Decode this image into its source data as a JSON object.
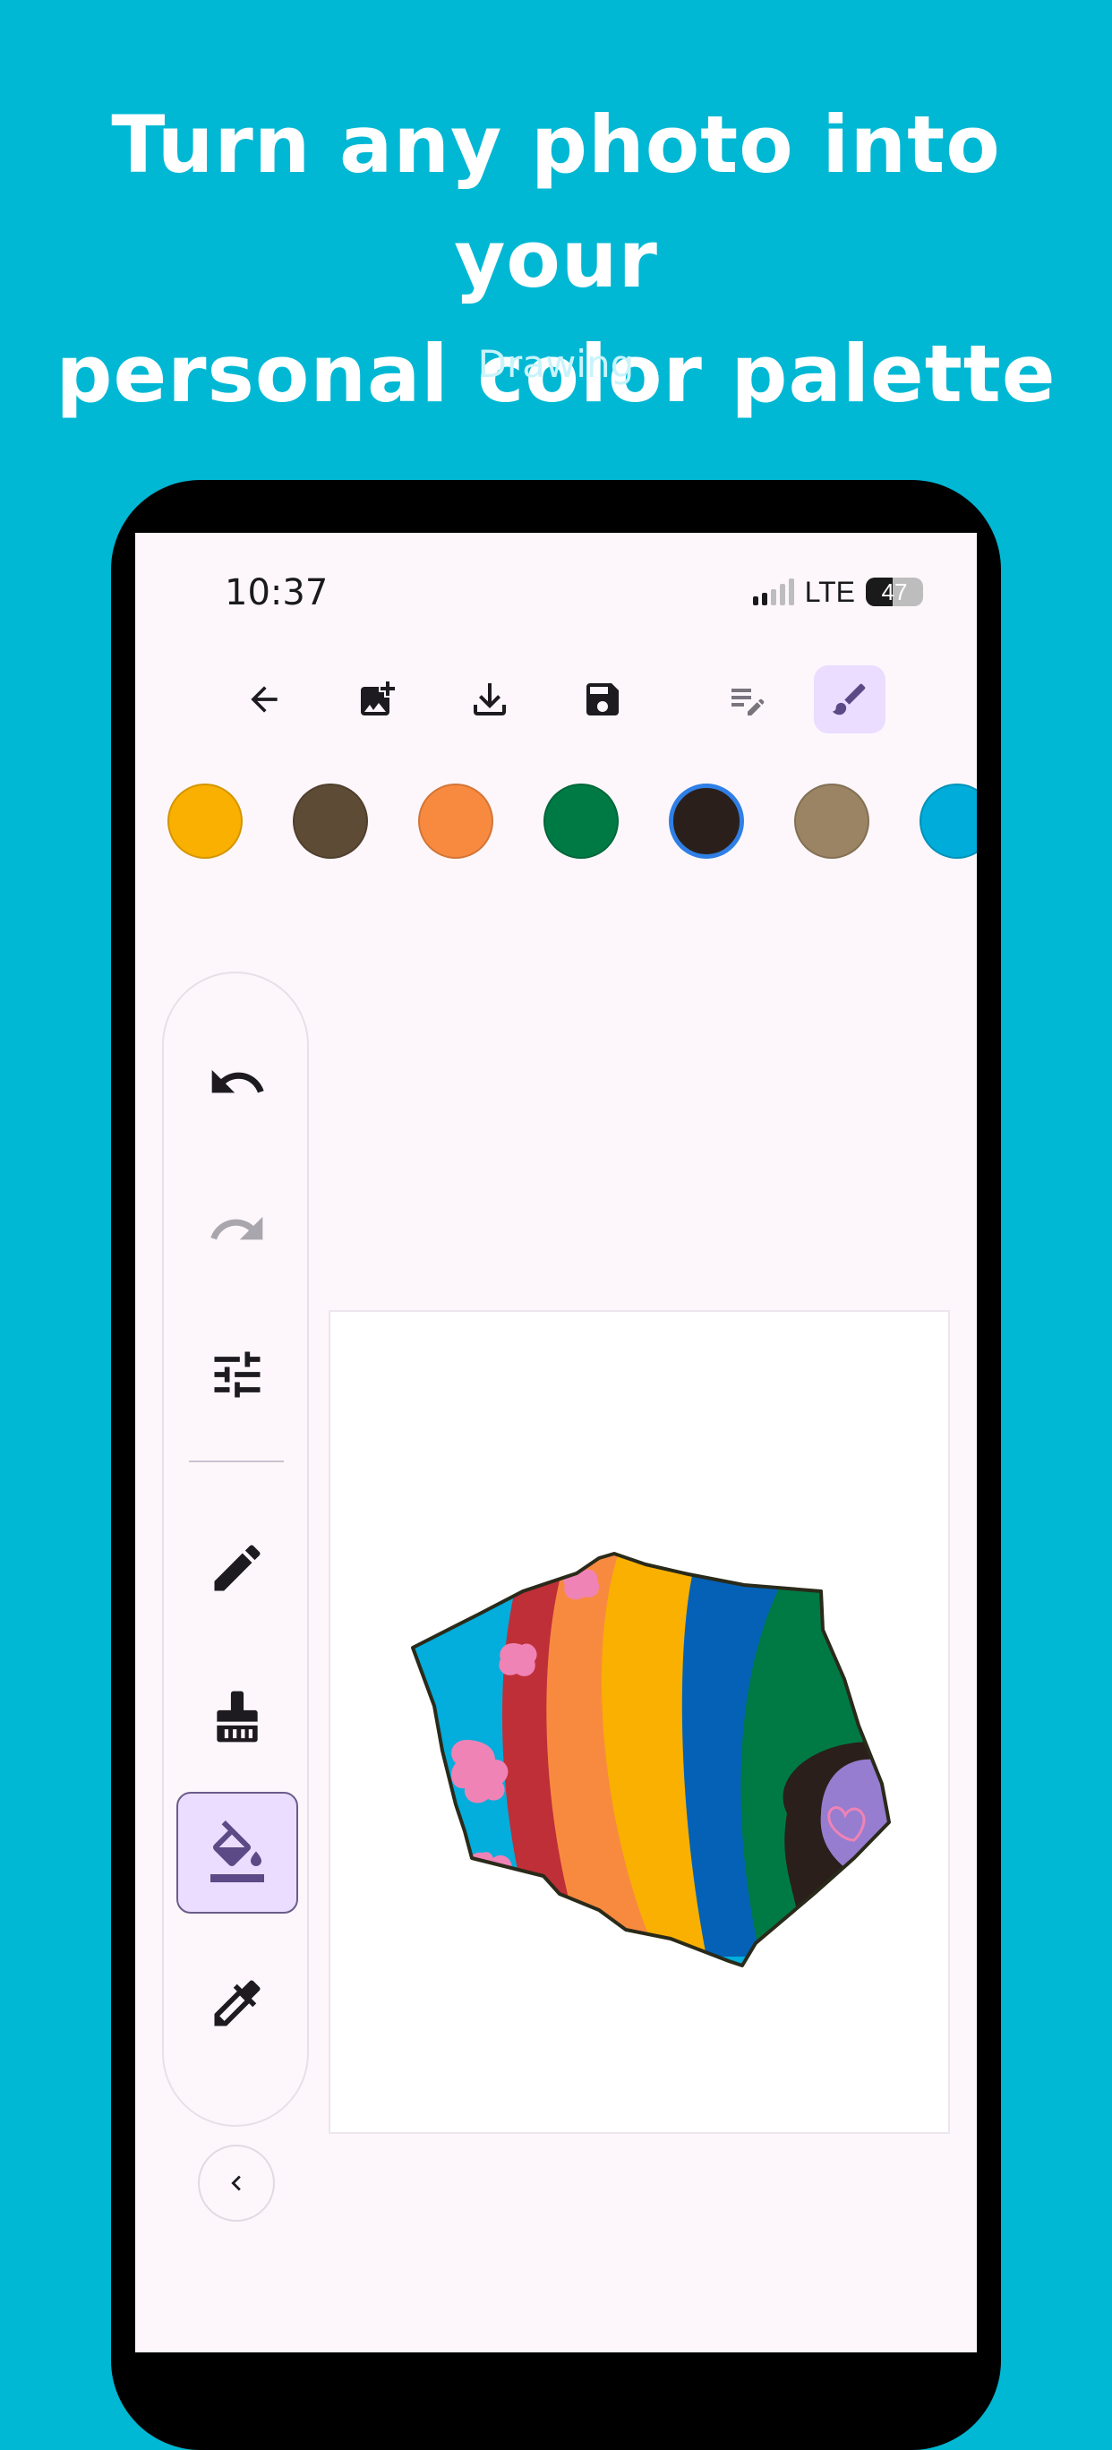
{
  "header": {
    "title_line1": "Turn any photo into your",
    "title_line2": "personal color palette",
    "subtitle": "Drawing"
  },
  "statusbar": {
    "time": "10:37",
    "network": "LTE",
    "battery": "47"
  },
  "toolbar": {
    "buttons": [
      {
        "name": "back-button",
        "icon": "arrow-left-icon"
      },
      {
        "name": "add-image-button",
        "icon": "add-photo-icon"
      },
      {
        "name": "download-button",
        "icon": "download-icon"
      },
      {
        "name": "save-button",
        "icon": "save-icon"
      },
      {
        "name": "text-edit-mode-button",
        "icon": "edit-note-icon"
      },
      {
        "name": "brush-mode-button",
        "icon": "brush-icon",
        "active": true
      }
    ]
  },
  "palette": {
    "colors": [
      "#f9b000",
      "#5e4b35",
      "#f88a40",
      "#007a45",
      "#2a1f1a",
      "#9a8463",
      "#00acd9"
    ],
    "selected_index": 4
  },
  "tools": {
    "items": [
      {
        "name": "undo",
        "icon": "undo-icon",
        "enabled": true
      },
      {
        "name": "redo",
        "icon": "redo-icon",
        "enabled": false
      },
      {
        "name": "adjust",
        "icon": "tune-icon"
      },
      {
        "name": "pencil",
        "icon": "pencil-icon"
      },
      {
        "name": "brush",
        "icon": "cleaning-brush-icon"
      },
      {
        "name": "fill",
        "icon": "paint-bucket-icon",
        "active": true
      },
      {
        "name": "eyedropper",
        "icon": "eyedropper-icon"
      }
    ],
    "collapse_icon": "chevron-left-icon"
  },
  "colors": {
    "background": "#00b8d4",
    "screen": "#fdf7fb",
    "active_tool": "#eaddff",
    "selection_ring": "#2f7fe6"
  }
}
